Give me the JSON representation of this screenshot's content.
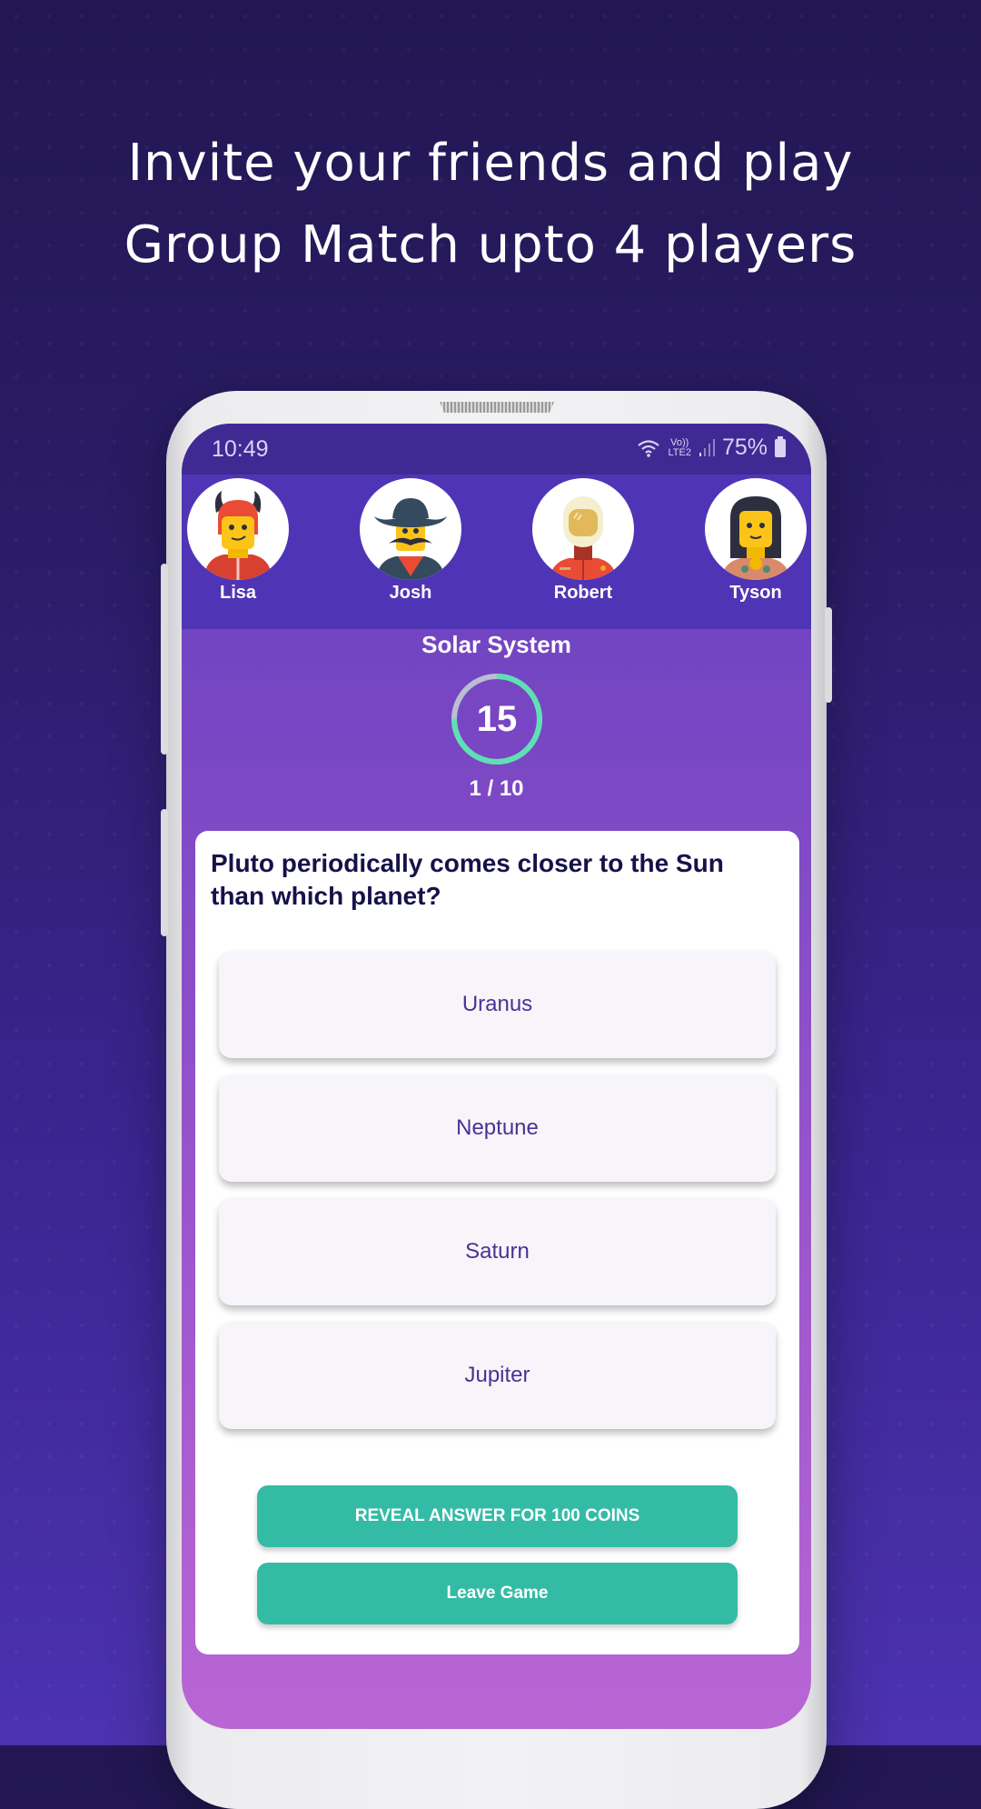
{
  "promo": {
    "headline_line1": "Invite your friends and play",
    "headline_line2": "Group Match upto 4 players"
  },
  "status_bar": {
    "time": "10:49",
    "network_label_top": "Vo))",
    "network_label_bottom": "LTE2",
    "battery": "75%",
    "icons": [
      "wifi-icon",
      "signal-icon",
      "battery-icon"
    ]
  },
  "players": [
    {
      "name": "Lisa",
      "avatar": "devil-avatar"
    },
    {
      "name": "Josh",
      "avatar": "cowboy-avatar"
    },
    {
      "name": "Robert",
      "avatar": "astronaut-avatar"
    },
    {
      "name": "Tyson",
      "avatar": "tribal-avatar"
    }
  ],
  "quiz": {
    "topic": "Solar System",
    "timer_seconds": "15",
    "timer_remaining_fraction": 0.75,
    "progress": "1 / 10",
    "question": "Pluto periodically comes closer to the Sun than which planet?",
    "answers": [
      "Uranus",
      "Neptune",
      "Saturn",
      "Jupiter"
    ],
    "reveal_button": "REVEAL ANSWER FOR 100 COINS",
    "leave_button": "Leave Game"
  },
  "colors": {
    "accent": "#34bba5",
    "timer_ring": "#5fe0b4",
    "timer_track": "#b9bfd0",
    "player_bar": "#4f35b5",
    "status_bar": "#3f2a94",
    "answer_text": "#4a3294",
    "question_text": "#15124a"
  }
}
